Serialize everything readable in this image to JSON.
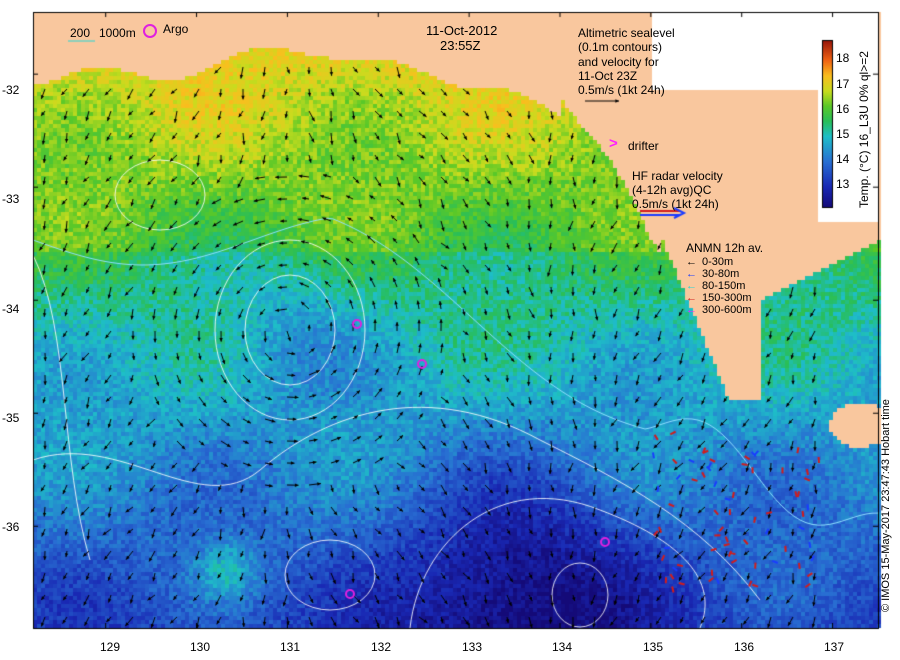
{
  "title": {
    "date": "11-Oct-2012",
    "time": "23:55Z"
  },
  "bathy_legend": {
    "depth_200": "200",
    "depth_1000": "1000m",
    "argo_label": "Argo"
  },
  "altimetry_note": {
    "line1": "Altimetric sealevel",
    "line2": "(0.1m contours)",
    "line3": "and velocity for",
    "line4": "11-Oct 23Z",
    "line5": "0.5m/s (1kt 24h)"
  },
  "drifter_label": "drifter",
  "hf_radar": {
    "line1": "HF radar velocity",
    "line2": "(4-12h avg)QC",
    "line3": "0.5m/s (1kt 24h)"
  },
  "anmn": {
    "title": "ANMN 12h av.",
    "rows": [
      {
        "label": "0-30m",
        "color": "#000000"
      },
      {
        "label": "30-80m",
        "color": "#1a3cff"
      },
      {
        "label": "80-150m",
        "color": "#21d6d6"
      },
      {
        "label": "150-300m",
        "color": "#d21c1c"
      },
      {
        "label": "300-600m",
        "color": "#ff1aff"
      }
    ]
  },
  "colorbar": {
    "title": "Temp. (°C) 16_L3U 0% ql>=2",
    "ticks": [
      "18",
      "17",
      "16",
      "15",
      "14",
      "13"
    ],
    "tick_values": [
      18,
      17,
      16,
      15,
      14,
      13
    ],
    "range": [
      12.2,
      18.8
    ]
  },
  "x_axis": {
    "ticks": [
      "129",
      "130",
      "131",
      "132",
      "133",
      "134",
      "135",
      "136",
      "137"
    ],
    "values": [
      129,
      130,
      131,
      132,
      133,
      134,
      135,
      136,
      137
    ],
    "range": [
      128.2,
      137.5
    ]
  },
  "y_axis": {
    "ticks": [
      "-32",
      "-33",
      "-34",
      "-35",
      "-36"
    ],
    "values": [
      -32,
      -33,
      -34,
      -35,
      -36
    ],
    "range": [
      -31.45,
      -36.9
    ]
  },
  "credit": "© IMOS 15-May-2017 23:47:43 Hobart time",
  "colors": {
    "land": "#f9c79e",
    "warm_sst": "#f0e62a",
    "mid_sst": "#21c43a",
    "cool_sst": "#2a8ed6",
    "cold_sst": "#1a2ab8"
  }
}
